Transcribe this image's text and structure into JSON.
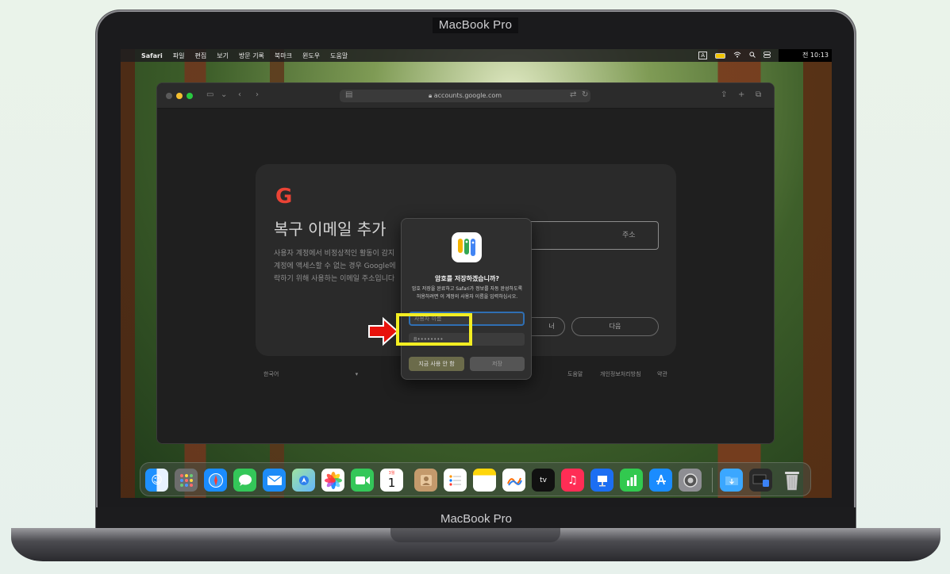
{
  "device": {
    "lid_label": "MacBook Pro",
    "base_label": "MacBook Pro"
  },
  "menubar": {
    "apple": "",
    "app": "Safari",
    "items": [
      "파일",
      "편집",
      "보기",
      "방문 기록",
      "북마크",
      "윈도우",
      "도움말"
    ],
    "input_indicator": "A",
    "clock": "전 10:13"
  },
  "browser": {
    "url": "accounts.google.com"
  },
  "google_page": {
    "logo": "G",
    "title": "복구 이메일 추가",
    "description": [
      "사용자 계정에서 비정상적인 활동이 감지",
      "계정에 액세스할 수 없는 경우 Google에",
      "락하기 위해 사용하는 이메일 주소입니다"
    ],
    "input_fragment": "주소",
    "skip_fragment": "너",
    "next_button": "다음",
    "language": "한국어",
    "footer": [
      "도움말",
      "개인정보처리방침",
      "약관"
    ]
  },
  "dialog": {
    "title": "암호를 저장하겠습니까?",
    "message": "암호 저장을 완료하고 Safari가 정보를 자동 완성하도록 허용하려면 이 계정의 사용자 이름을 입력하십시오.",
    "username_placeholder": "사용자 이름",
    "password_value": "8••••••••",
    "not_now": "지금 사용 안 함",
    "save": "저장"
  },
  "dock": {
    "calendar_month": "3월",
    "calendar_day": "1",
    "tv_label": "tv"
  },
  "colors": {
    "highlight": "#f3ee22",
    "arrow": "#e8120c"
  }
}
